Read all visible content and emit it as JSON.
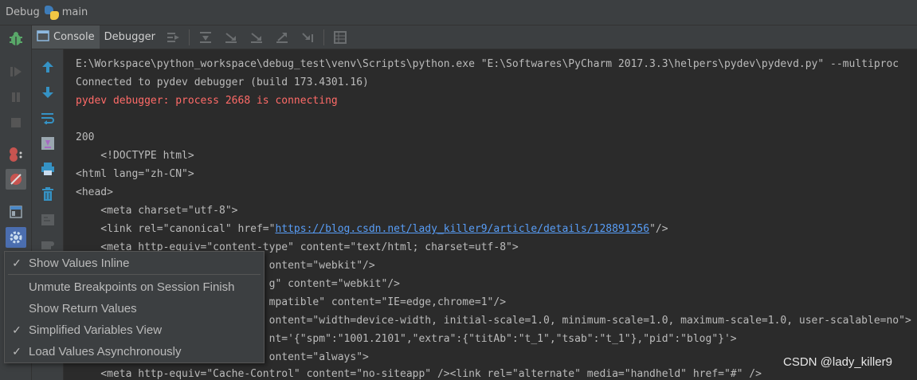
{
  "window": {
    "debug_label": "Debug",
    "config_name": "main"
  },
  "tabs": [
    {
      "label": "Console",
      "active": true
    },
    {
      "label": "Debugger",
      "active": false
    }
  ],
  "console": {
    "lines": [
      {
        "text": "E:\\Workspace\\python_workspace\\debug_test\\venv\\Scripts\\python.exe \"E:\\Softwares\\PyCharm 2017.3.3\\helpers\\pydev\\pydevd.py\" --multiproc",
        "style": "normal"
      },
      {
        "text": "Connected to pydev debugger (build 173.4301.16)",
        "style": "normal"
      },
      {
        "text": "pydev debugger: process 2668 is connecting",
        "style": "error"
      },
      {
        "text": "",
        "style": "normal"
      },
      {
        "text": "200",
        "style": "normal"
      },
      {
        "text": "    <!DOCTYPE html>",
        "style": "normal"
      },
      {
        "text": "<html lang=\"zh-CN\">",
        "style": "normal"
      },
      {
        "text": "<head>",
        "style": "normal"
      },
      {
        "text": "    <meta charset=\"utf-8\">",
        "style": "normal"
      },
      {
        "text": "    <link rel=\"canonical\" href=\"",
        "link": "https://blog.csdn.net/lady_killer9/article/details/128891256",
        "after": "\"/>",
        "style": "normal"
      },
      {
        "text": "    <meta http-equiv=\"content-type\" content=\"text/html; charset=utf-8\">",
        "style": "normal"
      },
      {
        "text": "                               ontent=\"webkit\"/>",
        "style": "normal"
      },
      {
        "text": "                               g\" content=\"webkit\"/>",
        "style": "normal"
      },
      {
        "text": "                               mpatible\" content=\"IE=edge,chrome=1\"/>",
        "style": "normal"
      },
      {
        "text": "                               ontent=\"width=device-width, initial-scale=1.0, minimum-scale=1.0, maximum-scale=1.0, user-scalable=no\">",
        "style": "normal"
      },
      {
        "text": "                               nt='{\"spm\":\"1001.2101\",\"extra\":{\"titAb\":\"t_1\",\"tsab\":\"t_1\"},\"pid\":\"blog\"}'>",
        "style": "normal"
      },
      {
        "text": "                               ontent=\"always\">",
        "style": "normal"
      },
      {
        "text": "    <meta http-equiv=\"Cache-Control\" content=\"no-siteapp\" /><link rel=\"alternate\" media=\"handheld\" href=\"#\" />",
        "style": "normal"
      }
    ]
  },
  "context_menu": {
    "items": [
      {
        "label": "Show Values Inline",
        "checked": true
      },
      {
        "label": "Unmute Breakpoints on Session Finish",
        "checked": false
      },
      {
        "label": "Show Return Values",
        "checked": false
      },
      {
        "label": "Simplified Variables View",
        "checked": true
      },
      {
        "label": "Load Values Asynchronously",
        "checked": true
      }
    ],
    "check_glyph": "✓"
  },
  "watermark": "CSDN @lady_killer9",
  "icons": {
    "titlebar": [
      "python-icon"
    ],
    "toolbar": [
      "show-execution-point-icon",
      "step-over-icon",
      "step-into-icon",
      "step-into-my-code-icon",
      "step-out-icon",
      "run-to-cursor-icon",
      "evaluate-expression-icon"
    ],
    "left": [
      "debug-bug-icon",
      "resume-icon",
      "pause-icon",
      "stop-icon",
      "view-breakpoints-icon",
      "mute-breakpoints-icon",
      "restore-layout-icon",
      "settings-gear-icon"
    ],
    "second": [
      "scroll-up-icon",
      "scroll-down-icon",
      "soft-wrap-icon",
      "scroll-to-end-icon",
      "print-icon",
      "clear-all-icon",
      "console-icon",
      "plugin-icon"
    ]
  },
  "colors": {
    "background": "#2b2b2b",
    "panel": "#3c3f41",
    "text": "#bbbbbb",
    "error": "#ff6b68",
    "link": "#589df6"
  }
}
